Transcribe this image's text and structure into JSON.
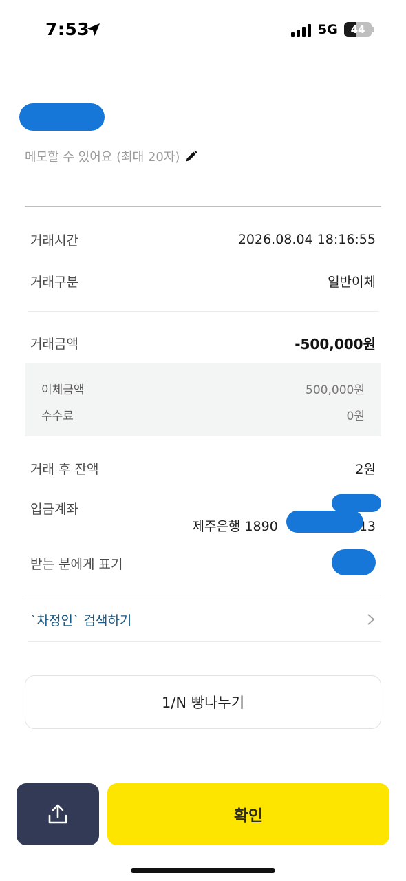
{
  "status_bar": {
    "time": "7:53",
    "network": "5G",
    "battery_percent": "44",
    "battery_level": 0.44
  },
  "header": {
    "memo_placeholder": "메모할 수 있어요 (최대 20자)"
  },
  "details": {
    "time_label": "거래시간",
    "time_value": "2026.08.04 18:16:55",
    "type_label": "거래구분",
    "type_value": "일반이체",
    "amount_label": "거래금액",
    "amount_value": "-500,000원",
    "transfer_label": "이체금액",
    "transfer_value": "500,000원",
    "fee_label": "수수료",
    "fee_value": "0원",
    "balance_label": "거래 후 잔액",
    "balance_value": "2원",
    "account_label": "입금계좌",
    "account_value": "제주은행 1890",
    "account_suffix": "13",
    "recipient_label": "받는 분에게 표기"
  },
  "search": {
    "label": "`차정인` 검색하기"
  },
  "buttons": {
    "split": "1/N 빵나누기",
    "confirm": "확인"
  },
  "icons": {
    "location": "location-arrow-icon",
    "edit": "pencil-icon",
    "chevron": "chevron-right-icon",
    "share": "share-upload-icon"
  },
  "colors": {
    "confirm": "#fee500",
    "share": "#333a56",
    "search_link": "#1a5a85",
    "redaction": "#1677d9"
  }
}
